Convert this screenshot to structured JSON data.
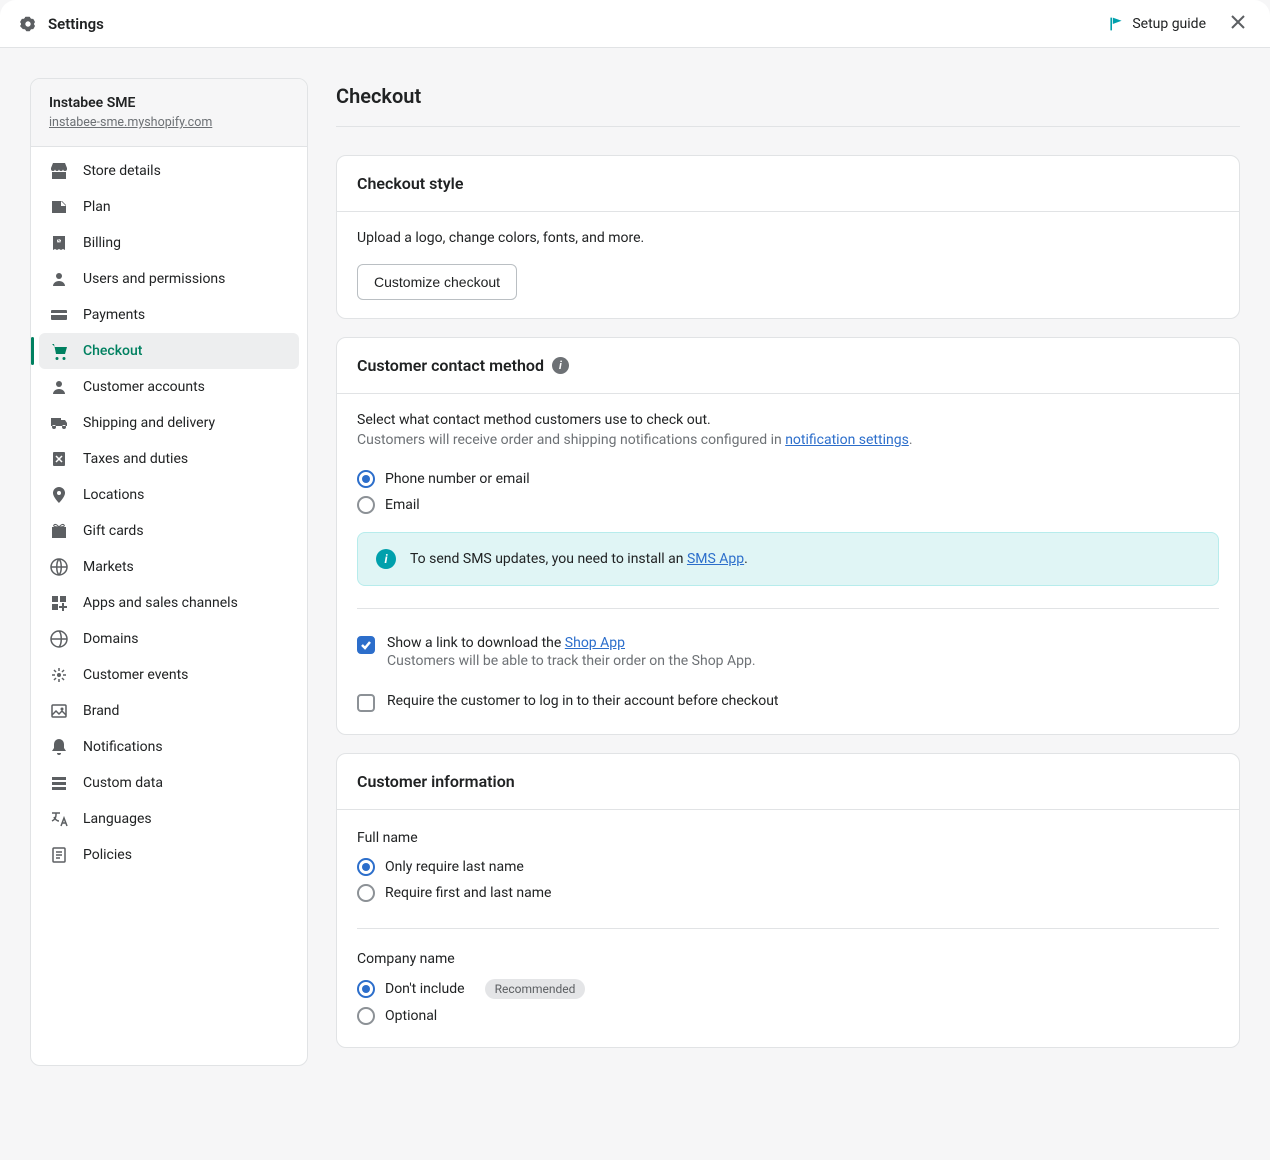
{
  "header": {
    "title": "Settings",
    "setup_guide": "Setup guide"
  },
  "store": {
    "name": "Instabee SME",
    "url": "instabee-sme.myshopify.com"
  },
  "nav": [
    {
      "id": "store-details",
      "label": "Store details",
      "icon": "store"
    },
    {
      "id": "plan",
      "label": "Plan",
      "icon": "plan"
    },
    {
      "id": "billing",
      "label": "Billing",
      "icon": "billing"
    },
    {
      "id": "users",
      "label": "Users and permissions",
      "icon": "user"
    },
    {
      "id": "payments",
      "label": "Payments",
      "icon": "payments"
    },
    {
      "id": "checkout",
      "label": "Checkout",
      "icon": "cart",
      "active": true
    },
    {
      "id": "customer-accounts",
      "label": "Customer accounts",
      "icon": "account"
    },
    {
      "id": "shipping",
      "label": "Shipping and delivery",
      "icon": "truck"
    },
    {
      "id": "taxes",
      "label": "Taxes and duties",
      "icon": "tax"
    },
    {
      "id": "locations",
      "label": "Locations",
      "icon": "pin"
    },
    {
      "id": "gift-cards",
      "label": "Gift cards",
      "icon": "gift"
    },
    {
      "id": "markets",
      "label": "Markets",
      "icon": "globe"
    },
    {
      "id": "apps",
      "label": "Apps and sales channels",
      "icon": "apps"
    },
    {
      "id": "domains",
      "label": "Domains",
      "icon": "domain"
    },
    {
      "id": "events",
      "label": "Customer events",
      "icon": "events"
    },
    {
      "id": "brand",
      "label": "Brand",
      "icon": "brand"
    },
    {
      "id": "notifications",
      "label": "Notifications",
      "icon": "bell"
    },
    {
      "id": "custom-data",
      "label": "Custom data",
      "icon": "data"
    },
    {
      "id": "languages",
      "label": "Languages",
      "icon": "lang"
    },
    {
      "id": "policies",
      "label": "Policies",
      "icon": "policy"
    }
  ],
  "page": {
    "title": "Checkout"
  },
  "style_card": {
    "title": "Checkout style",
    "desc": "Upload a logo, change colors, fonts, and more.",
    "button": "Customize checkout"
  },
  "contact_card": {
    "title": "Customer contact method",
    "desc": "Select what contact method customers use to check out.",
    "sub_pre": "Customers will receive order and shipping notifications configured in ",
    "sub_link": "notification settings",
    "radios": [
      {
        "label": "Phone number or email",
        "checked": true
      },
      {
        "label": "Email",
        "checked": false
      }
    ],
    "banner_pre": "To send SMS updates, you need to install an ",
    "banner_link": "SMS App",
    "shop_app_pre": "Show a link to download the ",
    "shop_app_link": "Shop App",
    "shop_app_sub": "Customers will be able to track their order on the Shop App.",
    "require_login": "Require the customer to log in to their account before checkout"
  },
  "info_card": {
    "title": "Customer information",
    "fullname_label": "Full name",
    "fullname_radios": [
      {
        "label": "Only require last name",
        "checked": true
      },
      {
        "label": "Require first and last name",
        "checked": false
      }
    ],
    "company_label": "Company name",
    "company_radios": [
      {
        "label": "Don't include",
        "checked": true,
        "badge": "Recommended"
      },
      {
        "label": "Optional",
        "checked": false
      }
    ]
  }
}
